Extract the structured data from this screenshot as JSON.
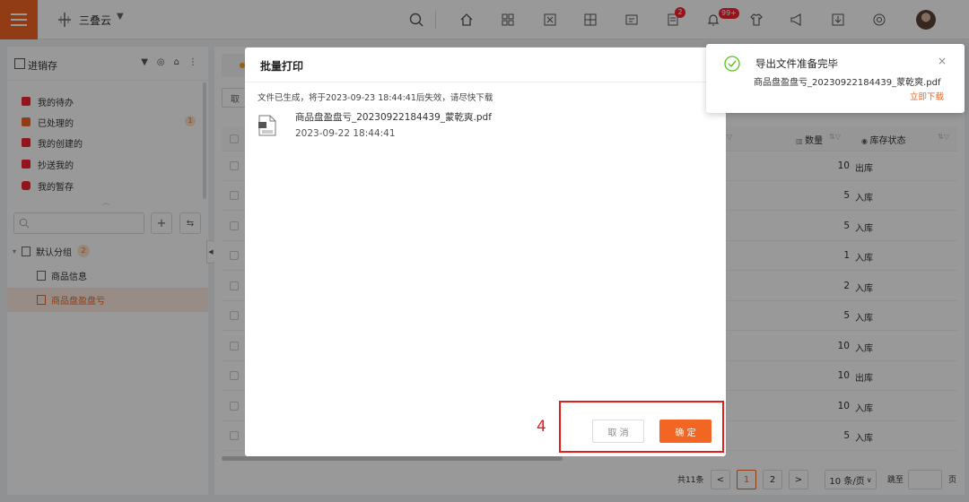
{
  "app": {
    "name": "三叠云"
  },
  "colors": {
    "accent": "#f26522",
    "badge": "#f5222d",
    "success": "#52c41a",
    "annotation": "#e51c1c"
  },
  "header": {
    "icons": [
      "search-icon",
      "home-icon",
      "apps-grid-icon",
      "scan-icon",
      "widget-icon",
      "form-icon",
      "task-list-icon",
      "bell-icon",
      "shirt-icon",
      "megaphone-icon",
      "download-icon",
      "settings-icon"
    ],
    "task_badge": "2",
    "bell_badge": "99+"
  },
  "sidebar": {
    "title": "进销存",
    "items": [
      {
        "label": "我的待办",
        "count": ""
      },
      {
        "label": "已处理的",
        "count": "1"
      },
      {
        "label": "我的创建的",
        "count": ""
      },
      {
        "label": "抄送我的",
        "count": ""
      },
      {
        "label": "我的暂存",
        "count": ""
      }
    ],
    "group": {
      "label": "默认分组",
      "count": "2"
    },
    "forms": [
      {
        "label": "商品信息"
      },
      {
        "label": "商品盘盈盘亏"
      }
    ]
  },
  "main": {
    "toolbar_btn": "取",
    "columns": {
      "qty": "数量",
      "status": "库存状态"
    },
    "rows": [
      {
        "qty": "10",
        "status": "出库"
      },
      {
        "qty": "5",
        "status": "入库"
      },
      {
        "qty": "5",
        "status": "入库"
      },
      {
        "qty": "1",
        "status": "入库"
      },
      {
        "qty": "2",
        "status": "入库"
      },
      {
        "qty": "5",
        "status": "入库"
      },
      {
        "qty": "10",
        "status": "入库"
      },
      {
        "qty": "10",
        "status": "出库"
      },
      {
        "qty": "10",
        "status": "入库"
      },
      {
        "qty": "5",
        "status": "入库"
      }
    ],
    "pagination": {
      "total": "共11条",
      "prev": "<",
      "pages": [
        "1",
        "2"
      ],
      "next": ">",
      "page_size": "10 条/页",
      "jump_label": "跳至",
      "jump_suffix": "页"
    }
  },
  "modal": {
    "title": "批量打印",
    "notice": "文件已生成，将于2023-09-23 18:44:41后失效，请尽快下载",
    "file_name": "商品盘盈盘亏_20230922184439_蒙乾爽.pdf",
    "file_time": "2023-09-22 18:44:41",
    "cancel_label": "取 消",
    "ok_label": "确 定"
  },
  "toast": {
    "title": "导出文件准备完毕",
    "file": "商品盘盈盘亏_20230922184439_蒙乾爽.pdf",
    "download_label": "立即下载"
  },
  "annotation": {
    "label": "4"
  }
}
